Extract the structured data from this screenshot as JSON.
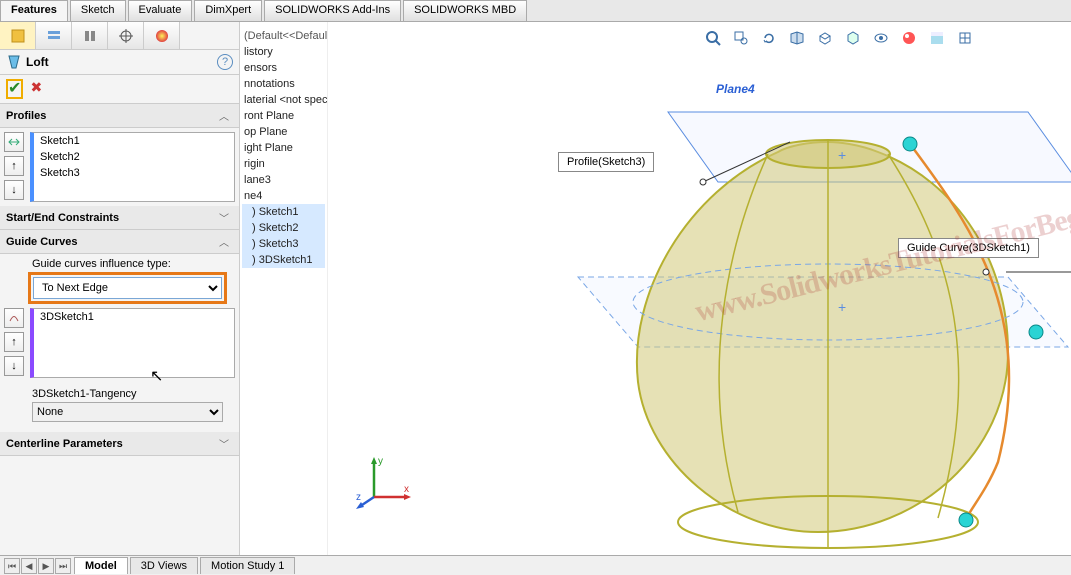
{
  "cmd_tabs": [
    "Features",
    "Sketch",
    "Evaluate",
    "DimXpert",
    "SOLIDWORKS Add-Ins",
    "SOLIDWORKS MBD"
  ],
  "active_cmd_tab": 0,
  "feature": {
    "name": "Loft"
  },
  "sections": {
    "profiles": {
      "title": "Profiles",
      "items": [
        "Sketch1",
        "Sketch2",
        "Sketch3"
      ]
    },
    "startend": {
      "title": "Start/End Constraints"
    },
    "guide": {
      "title": "Guide Curves",
      "influence_label": "Guide curves influence type:",
      "influence_value": "To Next Edge",
      "items": [
        "3DSketch1"
      ],
      "tangency_label": "3DSketch1-Tangency",
      "tangency_value": "None"
    },
    "centerline": {
      "title": "Centerline Parameters"
    }
  },
  "tree": {
    "display_state": "(Default<<Default>_Display State ...",
    "items": [
      "listory",
      "ensors",
      "nnotations",
      "laterial <not specified>",
      "ront Plane",
      "op Plane",
      "ight Plane",
      "rigin",
      "lane3",
      "ne4"
    ],
    "sketches": [
      ") Sketch1",
      ") Sketch2",
      ") Sketch3",
      ") 3DSketch1"
    ]
  },
  "viewport": {
    "plane_top": "Plane4",
    "callout_profile": "Profile(Sketch3)",
    "callout_guide": "Guide Curve(3DSketch1)"
  },
  "watermark_text": "www.SolidworksTutorialsForBeginners.com",
  "bottom_tabs": [
    "Model",
    "3D Views",
    "Motion Study 1"
  ],
  "active_bottom_tab": 0,
  "triad": {
    "x": "x",
    "y": "y",
    "z": "z"
  }
}
